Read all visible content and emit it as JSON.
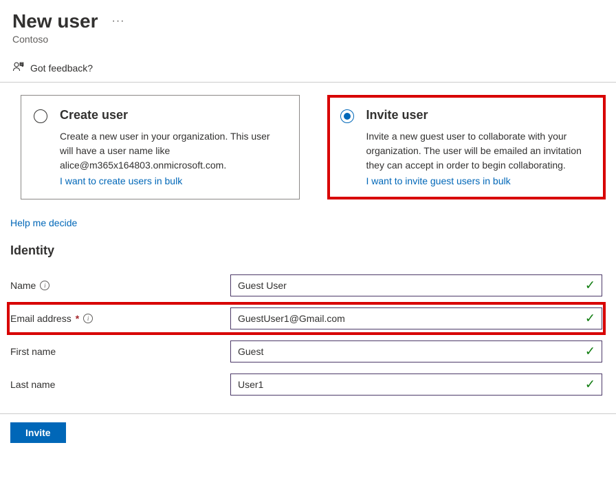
{
  "header": {
    "title": "New user",
    "subtitle": "Contoso"
  },
  "feedback": {
    "text": "Got feedback?"
  },
  "options": {
    "create": {
      "title": "Create user",
      "description": "Create a new user in your organization. This user will have a user name like alice@m365x164803.onmicrosoft.com.",
      "link": "I want to create users in bulk",
      "selected": false
    },
    "invite": {
      "title": "Invite user",
      "description": "Invite a new guest user to collaborate with your organization. The user will be emailed an invitation they can accept in order to begin collaborating.",
      "link": "I want to invite guest users in bulk",
      "selected": true
    }
  },
  "help_link": "Help me decide",
  "section_title": "Identity",
  "fields": {
    "name": {
      "label": "Name",
      "value": "Guest User",
      "required": false,
      "has_info": true
    },
    "email": {
      "label": "Email address",
      "value": "GuestUser1@Gmail.com",
      "required": true,
      "has_info": true
    },
    "first_name": {
      "label": "First name",
      "value": "Guest",
      "required": false,
      "has_info": false
    },
    "last_name": {
      "label": "Last name",
      "value": "User1",
      "required": false,
      "has_info": false
    }
  },
  "footer": {
    "invite_button": "Invite"
  }
}
